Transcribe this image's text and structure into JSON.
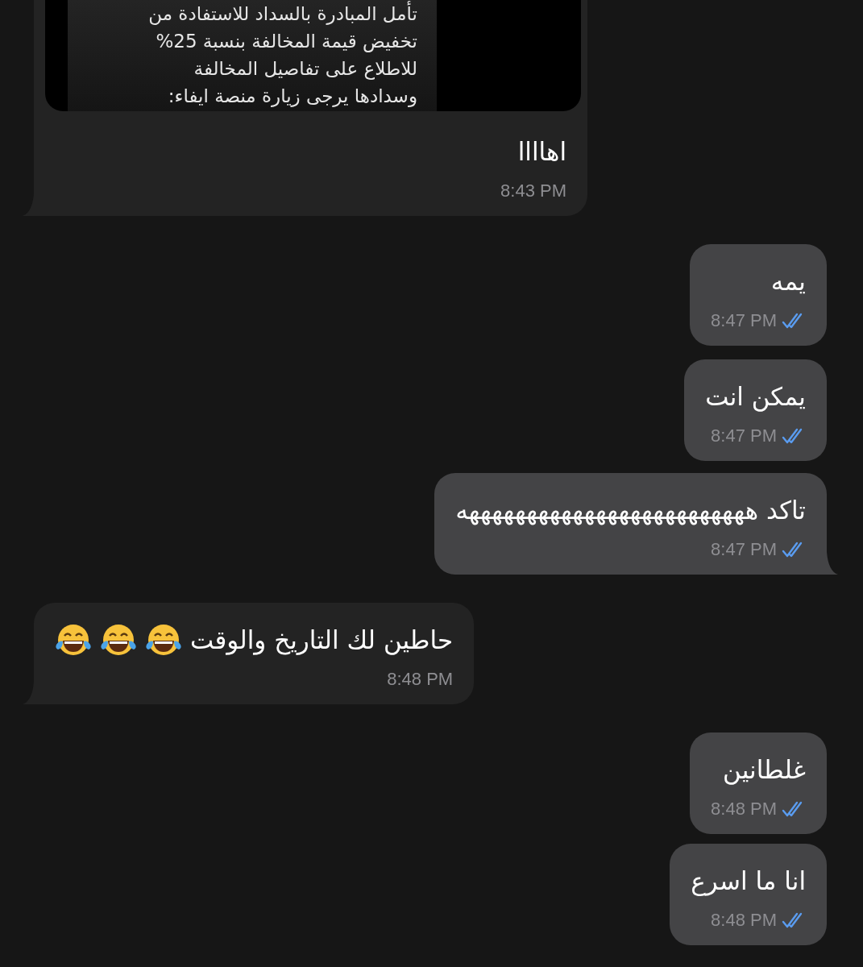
{
  "messages": [
    {
      "kind": "incoming",
      "quote": {
        "lines": [
          "تأمل المبادرة بالسداد للاستفادة من",
          "تخفيض قيمة المخالفة بنسبة 25%",
          "للاطلاع على تفاصيل المخالفة",
          "وسدادها يرجى زيارة منصة ايفاء:"
        ]
      },
      "text": "اهاااا",
      "time": "8:43 PM",
      "tail": true
    },
    {
      "kind": "outgoing",
      "text": "يمه",
      "time": "8:47 PM",
      "read": true,
      "tail": false
    },
    {
      "kind": "outgoing",
      "text": "يمكن انت",
      "time": "8:47 PM",
      "read": true,
      "tail": false
    },
    {
      "kind": "outgoing",
      "text": "تاكد هههههههههههههههههههههههههه",
      "time": "8:47 PM",
      "read": true,
      "tail": true
    },
    {
      "kind": "incoming",
      "text": "حاطين لك التاريخ والوقت",
      "emojis": [
        {
          "kind": "tears-of-joy"
        },
        {
          "kind": "tears-of-joy"
        },
        {
          "kind": "tears-of-joy"
        }
      ],
      "time": "8:48 PM",
      "tail": true
    },
    {
      "kind": "outgoing",
      "text": "غلطانين",
      "time": "8:48 PM",
      "read": true,
      "tail": false
    },
    {
      "kind": "outgoing",
      "text": "انا ما اسرع",
      "time": "8:48 PM",
      "read": true,
      "tail": false
    }
  ]
}
